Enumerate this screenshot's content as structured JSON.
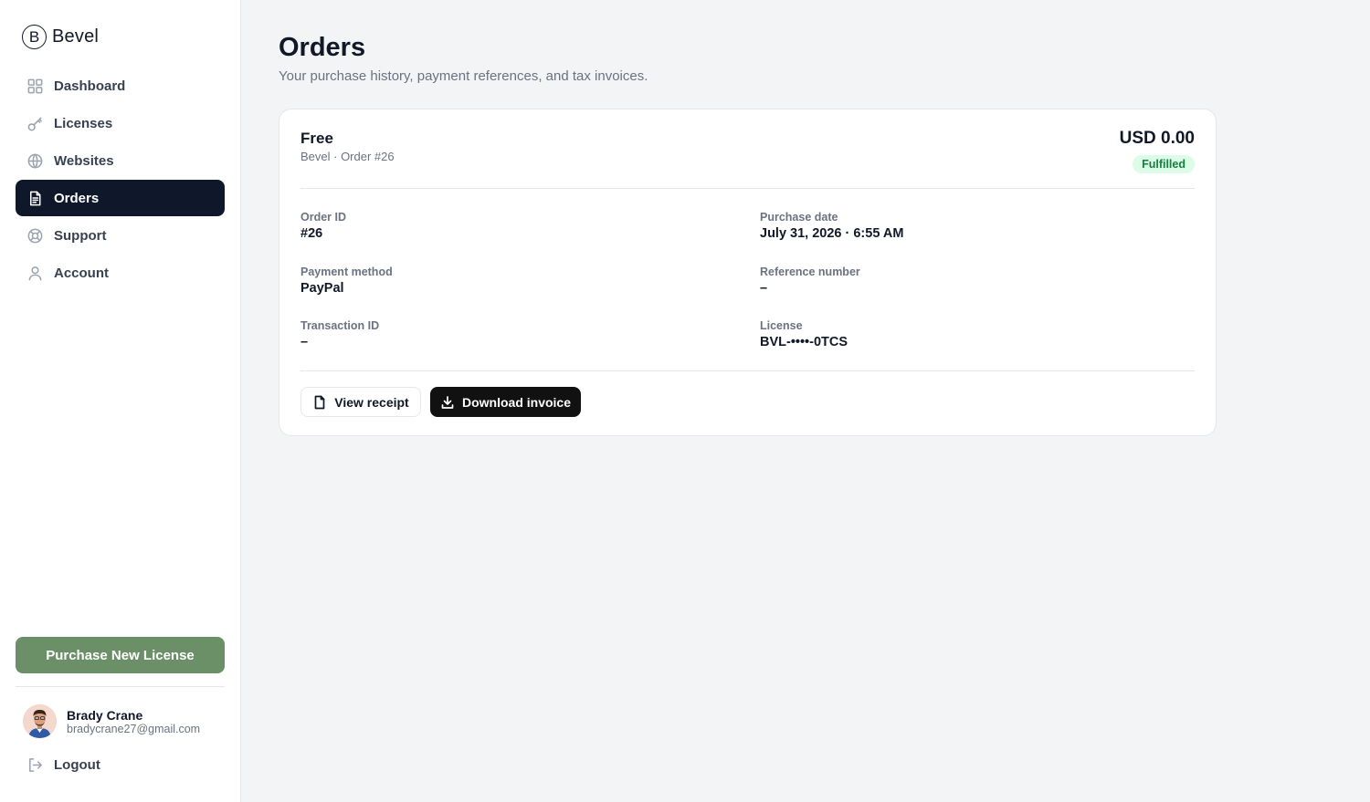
{
  "brand": {
    "logo_letter": "B",
    "name": "Bevel"
  },
  "sidebar": {
    "items": [
      {
        "label": "Dashboard",
        "icon": "grid-icon"
      },
      {
        "label": "Licenses",
        "icon": "key-icon"
      },
      {
        "label": "Websites",
        "icon": "globe-icon"
      },
      {
        "label": "Orders",
        "icon": "document-icon",
        "active": true
      },
      {
        "label": "Support",
        "icon": "lifebuoy-icon"
      },
      {
        "label": "Account",
        "icon": "user-icon"
      }
    ],
    "purchase_button": "Purchase New License",
    "user": {
      "name": "Brady Crane",
      "email": "bradycrane27@gmail.com"
    },
    "logout": "Logout"
  },
  "page": {
    "title": "Orders",
    "subtitle": "Your purchase history, payment references, and tax invoices."
  },
  "order": {
    "plan": "Free",
    "meta": "Bevel · Order #26",
    "amount": "USD 0.00",
    "status": "Fulfilled",
    "fields": {
      "order_id": {
        "label": "Order ID",
        "value": "#26"
      },
      "purchase_date": {
        "label": "Purchase date",
        "value": "July 31, 2026 · 6:55 AM"
      },
      "payment_method": {
        "label": "Payment method",
        "value": "PayPal"
      },
      "reference_number": {
        "label": "Reference number",
        "value": "–"
      },
      "transaction_id": {
        "label": "Transaction ID",
        "value": "–"
      },
      "license": {
        "label": "License",
        "value": "BVL-••••-0TCS"
      }
    },
    "actions": {
      "view_receipt": "View receipt",
      "download_invoice": "Download invoice"
    }
  },
  "colors": {
    "active_nav_bg": "#0f172a",
    "purchase_button": "#6b8f66",
    "status_badge_bg": "#dcfce7",
    "status_badge_text": "#15803d",
    "download_button": "#111111"
  }
}
